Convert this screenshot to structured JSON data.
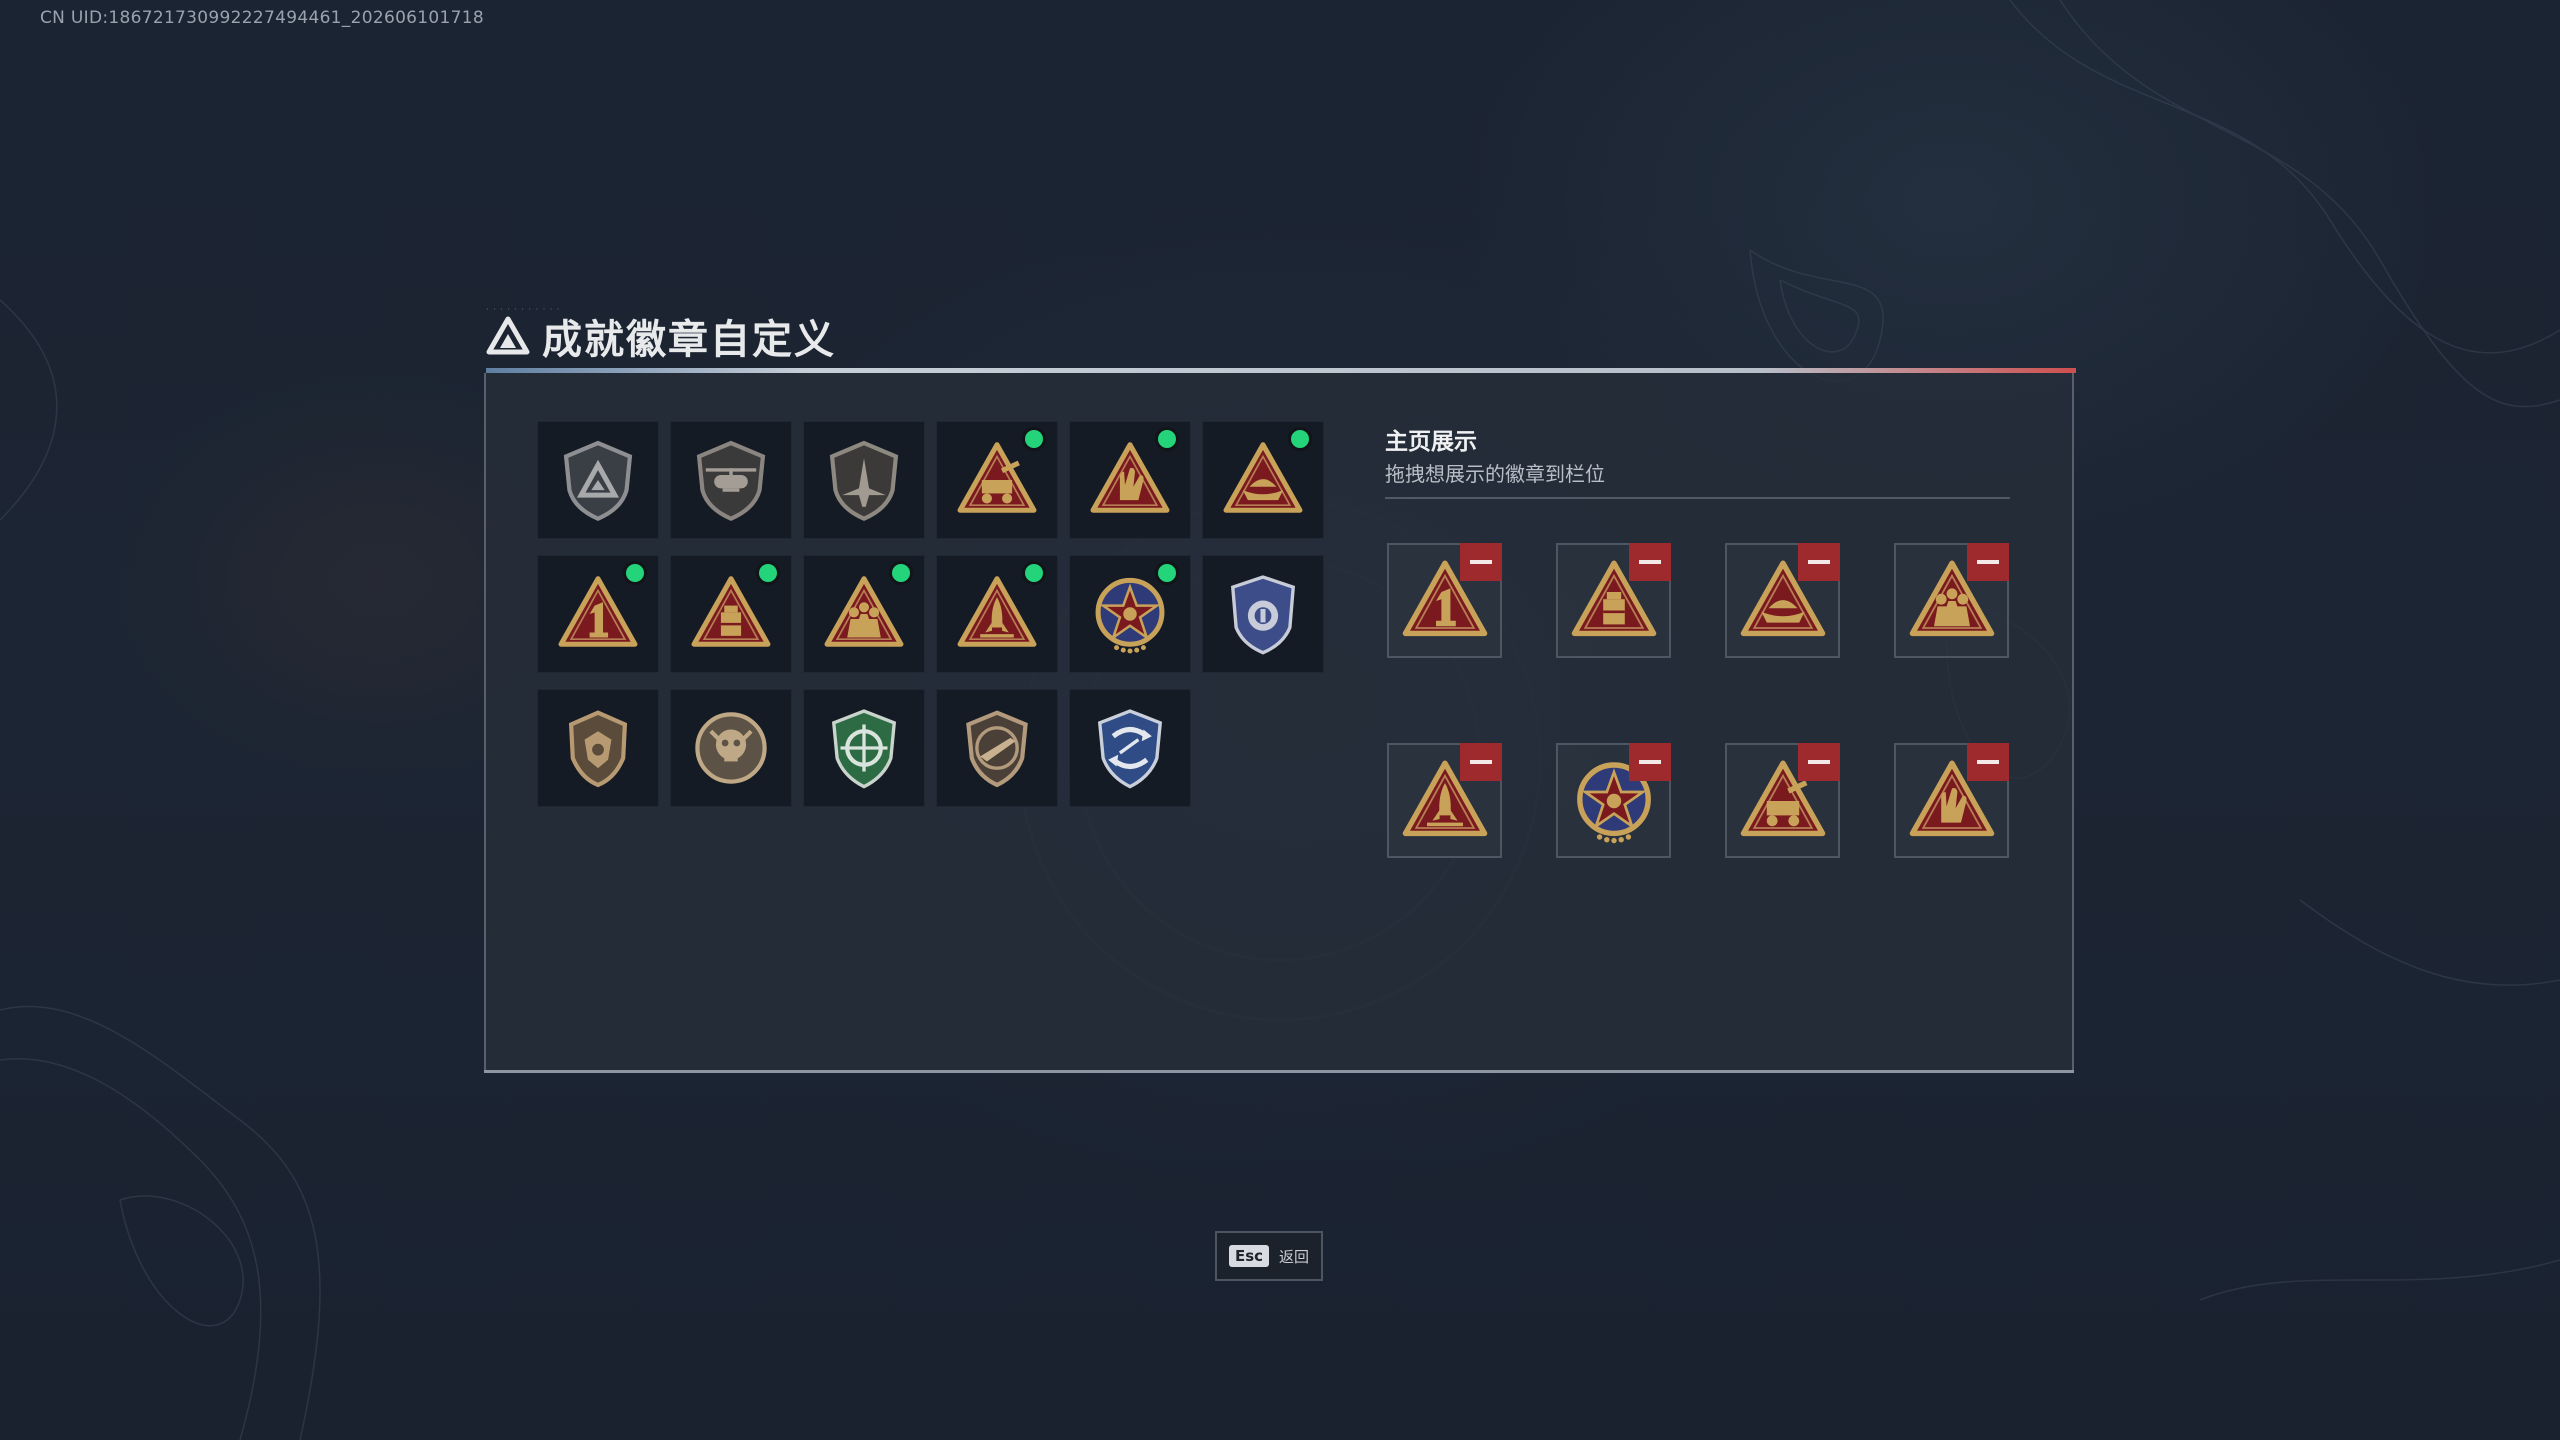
{
  "uid_text": "CN UID:18672173099222749446​1_202606101718",
  "page": {
    "title": "成就徽章自定义",
    "title_icon": "triangle-logo-icon"
  },
  "colors": {
    "accent_red": "#9e2a2e",
    "new_dot": "#24d47a",
    "gold": "#c9a25a",
    "crimson": "#7a1a1f"
  },
  "badges": [
    {
      "name": "shield-triangle-badge-icon",
      "new": false
    },
    {
      "name": "helicopter-shield-badge-icon",
      "new": false
    },
    {
      "name": "jet-shield-badge-icon",
      "new": false
    },
    {
      "name": "artillery-triangle-badge-icon",
      "new": true
    },
    {
      "name": "hand-sign-triangle-badge-icon",
      "new": true
    },
    {
      "name": "boat-triangle-badge-icon",
      "new": true
    },
    {
      "name": "number-one-triangle-badge-icon",
      "new": true
    },
    {
      "name": "supply-crate-triangle-badge-icon",
      "new": true
    },
    {
      "name": "soldiers-triangle-badge-icon",
      "new": true
    },
    {
      "name": "rocket-triangle-badge-icon",
      "new": true
    },
    {
      "name": "star-wreath-medal-icon",
      "new": true
    },
    {
      "name": "blue-police-shield-badge-icon",
      "new": false
    },
    {
      "name": "bronze-crest-badge-icon",
      "new": false
    },
    {
      "name": "bronze-skull-round-badge-icon",
      "new": false
    },
    {
      "name": "green-crosshair-shield-badge-icon",
      "new": false
    },
    {
      "name": "rifle-shield-badge-icon",
      "new": false
    },
    {
      "name": "blue-arrows-shield-badge-icon",
      "new": false
    }
  ],
  "showcase": {
    "title": "主页展示",
    "subtitle": "拖拽想展示的徽章到栏位",
    "slots": [
      {
        "name": "number-one-triangle-badge-icon"
      },
      {
        "name": "supply-crate-triangle-badge-icon"
      },
      {
        "name": "boat-triangle-badge-icon"
      },
      {
        "name": "soldiers-triangle-badge-icon"
      },
      {
        "name": "rocket-triangle-badge-icon"
      },
      {
        "name": "star-wreath-medal-icon"
      },
      {
        "name": "artillery-triangle-badge-icon"
      },
      {
        "name": "hand-sign-triangle-badge-icon"
      }
    ]
  },
  "footer": {
    "esc_key": "Esc",
    "esc_label": "返回"
  }
}
